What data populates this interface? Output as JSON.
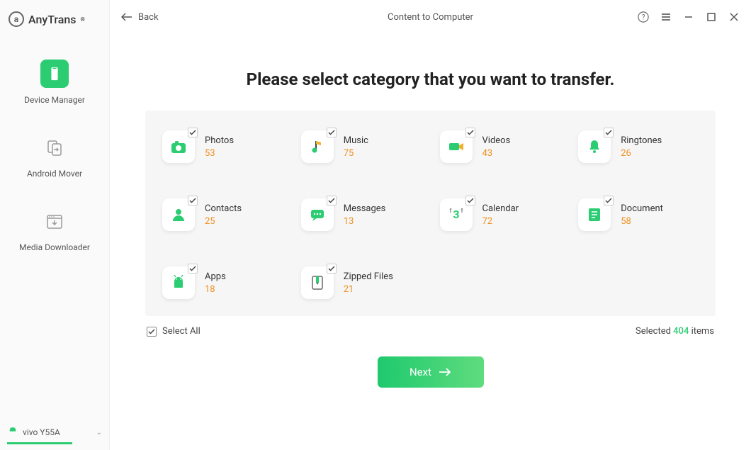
{
  "brand": {
    "name": "AnyTrans",
    "reg": "®"
  },
  "sidebar": {
    "items": [
      {
        "label": "Device Manager"
      },
      {
        "label": "Android Mover"
      },
      {
        "label": "Media Downloader"
      }
    ]
  },
  "device": {
    "name": "vivo Y55A"
  },
  "topbar": {
    "back": "Back",
    "title": "Content to Computer"
  },
  "heading": "Please select category that you want to transfer.",
  "categories": [
    {
      "name": "Photos",
      "count": "53"
    },
    {
      "name": "Music",
      "count": "75"
    },
    {
      "name": "Videos",
      "count": "43"
    },
    {
      "name": "Ringtones",
      "count": "26"
    },
    {
      "name": "Contacts",
      "count": "25"
    },
    {
      "name": "Messages",
      "count": "13"
    },
    {
      "name": "Calendar",
      "count": "72"
    },
    {
      "name": "Document",
      "count": "58"
    },
    {
      "name": "Apps",
      "count": "18"
    },
    {
      "name": "Zipped Files",
      "count": "21"
    }
  ],
  "selectAll": "Select All",
  "summary": {
    "prefix": "Selected ",
    "count": "404",
    "suffix": " items"
  },
  "next": "Next"
}
